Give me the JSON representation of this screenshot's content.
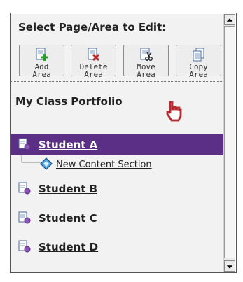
{
  "panel": {
    "title": "Select Page/Area to Edit:"
  },
  "toolbar": {
    "buttons": [
      {
        "line1": "Add",
        "line2": "Area",
        "icon": "add-area-icon"
      },
      {
        "line1": "Delete",
        "line2": "Area",
        "icon": "delete-area-icon"
      },
      {
        "line1": "Move",
        "line2": "Area",
        "icon": "move-area-icon"
      },
      {
        "line1": "Copy",
        "line2": "Area",
        "icon": "copy-area-icon"
      }
    ]
  },
  "tree": {
    "root": "My Class Portfolio",
    "items": [
      {
        "label": "Student A",
        "selected": true
      },
      {
        "label": "New Content Section",
        "child": true
      },
      {
        "label": "Student B"
      },
      {
        "label": "Student C"
      },
      {
        "label": "Student D"
      }
    ]
  },
  "colors": {
    "selection": "#5c2f86",
    "link": "#222222"
  }
}
